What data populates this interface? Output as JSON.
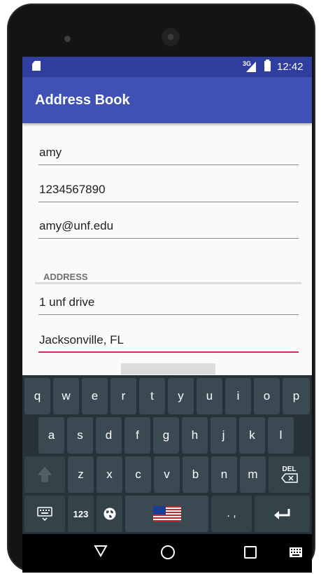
{
  "status_bar": {
    "network": "3G",
    "time": "12:42"
  },
  "app": {
    "title": "Address Book"
  },
  "form": {
    "name": "amy",
    "phone": "1234567890",
    "email": "amy@unf.edu",
    "address_section": "ADDRESS",
    "street": "1 unf drive",
    "city_state": "Jacksonville, FL"
  },
  "keyboard": {
    "row1": [
      "q",
      "w",
      "e",
      "r",
      "t",
      "y",
      "u",
      "i",
      "o",
      "p"
    ],
    "row2": [
      "a",
      "s",
      "d",
      "f",
      "g",
      "h",
      "j",
      "k",
      "l"
    ],
    "row3": [
      "z",
      "x",
      "c",
      "v",
      "b",
      "n",
      "m"
    ],
    "delete_label": "DEL",
    "numbers_label": "123",
    "punct_label": ". ,"
  },
  "colors": {
    "status_bar": "#303f9f",
    "app_bar": "#3f51b5",
    "focus_underline": "#e91e63",
    "keyboard_bg": "#263238",
    "key_bg": "#3b4a52"
  },
  "icons": {
    "sd_card": "sd-card-icon",
    "signal": "signal-icon",
    "battery": "battery-icon",
    "shift": "shift-icon",
    "backspace": "backspace-icon",
    "keyboard_switch": "keyboard-icon",
    "globe": "globe-icon",
    "space_flag": "us-flag-icon",
    "enter": "enter-icon",
    "nav_back": "back-triangle-icon",
    "nav_home": "home-circle-icon",
    "nav_recent": "recent-apps-icon",
    "nav_keyboard": "keyboard-picker-icon"
  }
}
